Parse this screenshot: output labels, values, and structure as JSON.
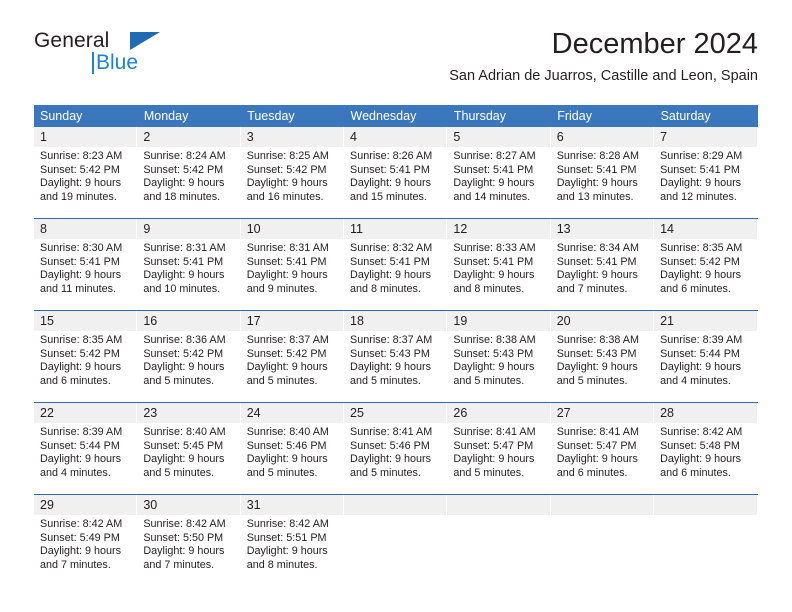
{
  "brand": {
    "name_part1": "General",
    "name_part2": "Blue",
    "triangle_color": "#1f6cb4",
    "blue_color": "#1f81d0"
  },
  "header": {
    "title": "December 2024",
    "subtitle": "San Adrian de Juarros, Castille and Leon, Spain"
  },
  "theme": {
    "header_bg": "#3b77bd",
    "header_text": "#ffffff",
    "daynum_bg": "#f0f0f0",
    "row_divider": "#2e6aa8",
    "body_text": "#231f20"
  },
  "calendar": {
    "weekday_headers": [
      "Sunday",
      "Monday",
      "Tuesday",
      "Wednesday",
      "Thursday",
      "Friday",
      "Saturday"
    ],
    "weeks": [
      [
        {
          "day": "1",
          "sunrise": "Sunrise: 8:23 AM",
          "sunset": "Sunset: 5:42 PM",
          "daylight_line1": "Daylight: 9 hours",
          "daylight_line2": "and 19 minutes."
        },
        {
          "day": "2",
          "sunrise": "Sunrise: 8:24 AM",
          "sunset": "Sunset: 5:42 PM",
          "daylight_line1": "Daylight: 9 hours",
          "daylight_line2": "and 18 minutes."
        },
        {
          "day": "3",
          "sunrise": "Sunrise: 8:25 AM",
          "sunset": "Sunset: 5:42 PM",
          "daylight_line1": "Daylight: 9 hours",
          "daylight_line2": "and 16 minutes."
        },
        {
          "day": "4",
          "sunrise": "Sunrise: 8:26 AM",
          "sunset": "Sunset: 5:41 PM",
          "daylight_line1": "Daylight: 9 hours",
          "daylight_line2": "and 15 minutes."
        },
        {
          "day": "5",
          "sunrise": "Sunrise: 8:27 AM",
          "sunset": "Sunset: 5:41 PM",
          "daylight_line1": "Daylight: 9 hours",
          "daylight_line2": "and 14 minutes."
        },
        {
          "day": "6",
          "sunrise": "Sunrise: 8:28 AM",
          "sunset": "Sunset: 5:41 PM",
          "daylight_line1": "Daylight: 9 hours",
          "daylight_line2": "and 13 minutes."
        },
        {
          "day": "7",
          "sunrise": "Sunrise: 8:29 AM",
          "sunset": "Sunset: 5:41 PM",
          "daylight_line1": "Daylight: 9 hours",
          "daylight_line2": "and 12 minutes."
        }
      ],
      [
        {
          "day": "8",
          "sunrise": "Sunrise: 8:30 AM",
          "sunset": "Sunset: 5:41 PM",
          "daylight_line1": "Daylight: 9 hours",
          "daylight_line2": "and 11 minutes."
        },
        {
          "day": "9",
          "sunrise": "Sunrise: 8:31 AM",
          "sunset": "Sunset: 5:41 PM",
          "daylight_line1": "Daylight: 9 hours",
          "daylight_line2": "and 10 minutes."
        },
        {
          "day": "10",
          "sunrise": "Sunrise: 8:31 AM",
          "sunset": "Sunset: 5:41 PM",
          "daylight_line1": "Daylight: 9 hours",
          "daylight_line2": "and 9 minutes."
        },
        {
          "day": "11",
          "sunrise": "Sunrise: 8:32 AM",
          "sunset": "Sunset: 5:41 PM",
          "daylight_line1": "Daylight: 9 hours",
          "daylight_line2": "and 8 minutes."
        },
        {
          "day": "12",
          "sunrise": "Sunrise: 8:33 AM",
          "sunset": "Sunset: 5:41 PM",
          "daylight_line1": "Daylight: 9 hours",
          "daylight_line2": "and 8 minutes."
        },
        {
          "day": "13",
          "sunrise": "Sunrise: 8:34 AM",
          "sunset": "Sunset: 5:41 PM",
          "daylight_line1": "Daylight: 9 hours",
          "daylight_line2": "and 7 minutes."
        },
        {
          "day": "14",
          "sunrise": "Sunrise: 8:35 AM",
          "sunset": "Sunset: 5:42 PM",
          "daylight_line1": "Daylight: 9 hours",
          "daylight_line2": "and 6 minutes."
        }
      ],
      [
        {
          "day": "15",
          "sunrise": "Sunrise: 8:35 AM",
          "sunset": "Sunset: 5:42 PM",
          "daylight_line1": "Daylight: 9 hours",
          "daylight_line2": "and 6 minutes."
        },
        {
          "day": "16",
          "sunrise": "Sunrise: 8:36 AM",
          "sunset": "Sunset: 5:42 PM",
          "daylight_line1": "Daylight: 9 hours",
          "daylight_line2": "and 5 minutes."
        },
        {
          "day": "17",
          "sunrise": "Sunrise: 8:37 AM",
          "sunset": "Sunset: 5:42 PM",
          "daylight_line1": "Daylight: 9 hours",
          "daylight_line2": "and 5 minutes."
        },
        {
          "day": "18",
          "sunrise": "Sunrise: 8:37 AM",
          "sunset": "Sunset: 5:43 PM",
          "daylight_line1": "Daylight: 9 hours",
          "daylight_line2": "and 5 minutes."
        },
        {
          "day": "19",
          "sunrise": "Sunrise: 8:38 AM",
          "sunset": "Sunset: 5:43 PM",
          "daylight_line1": "Daylight: 9 hours",
          "daylight_line2": "and 5 minutes."
        },
        {
          "day": "20",
          "sunrise": "Sunrise: 8:38 AM",
          "sunset": "Sunset: 5:43 PM",
          "daylight_line1": "Daylight: 9 hours",
          "daylight_line2": "and 5 minutes."
        },
        {
          "day": "21",
          "sunrise": "Sunrise: 8:39 AM",
          "sunset": "Sunset: 5:44 PM",
          "daylight_line1": "Daylight: 9 hours",
          "daylight_line2": "and 4 minutes."
        }
      ],
      [
        {
          "day": "22",
          "sunrise": "Sunrise: 8:39 AM",
          "sunset": "Sunset: 5:44 PM",
          "daylight_line1": "Daylight: 9 hours",
          "daylight_line2": "and 4 minutes."
        },
        {
          "day": "23",
          "sunrise": "Sunrise: 8:40 AM",
          "sunset": "Sunset: 5:45 PM",
          "daylight_line1": "Daylight: 9 hours",
          "daylight_line2": "and 5 minutes."
        },
        {
          "day": "24",
          "sunrise": "Sunrise: 8:40 AM",
          "sunset": "Sunset: 5:46 PM",
          "daylight_line1": "Daylight: 9 hours",
          "daylight_line2": "and 5 minutes."
        },
        {
          "day": "25",
          "sunrise": "Sunrise: 8:41 AM",
          "sunset": "Sunset: 5:46 PM",
          "daylight_line1": "Daylight: 9 hours",
          "daylight_line2": "and 5 minutes."
        },
        {
          "day": "26",
          "sunrise": "Sunrise: 8:41 AM",
          "sunset": "Sunset: 5:47 PM",
          "daylight_line1": "Daylight: 9 hours",
          "daylight_line2": "and 5 minutes."
        },
        {
          "day": "27",
          "sunrise": "Sunrise: 8:41 AM",
          "sunset": "Sunset: 5:47 PM",
          "daylight_line1": "Daylight: 9 hours",
          "daylight_line2": "and 6 minutes."
        },
        {
          "day": "28",
          "sunrise": "Sunrise: 8:42 AM",
          "sunset": "Sunset: 5:48 PM",
          "daylight_line1": "Daylight: 9 hours",
          "daylight_line2": "and 6 minutes."
        }
      ],
      [
        {
          "day": "29",
          "sunrise": "Sunrise: 8:42 AM",
          "sunset": "Sunset: 5:49 PM",
          "daylight_line1": "Daylight: 9 hours",
          "daylight_line2": "and 7 minutes."
        },
        {
          "day": "30",
          "sunrise": "Sunrise: 8:42 AM",
          "sunset": "Sunset: 5:50 PM",
          "daylight_line1": "Daylight: 9 hours",
          "daylight_line2": "and 7 minutes."
        },
        {
          "day": "31",
          "sunrise": "Sunrise: 8:42 AM",
          "sunset": "Sunset: 5:51 PM",
          "daylight_line1": "Daylight: 9 hours",
          "daylight_line2": "and 8 minutes."
        },
        {
          "day": "",
          "sunrise": "",
          "sunset": "",
          "daylight_line1": "",
          "daylight_line2": ""
        },
        {
          "day": "",
          "sunrise": "",
          "sunset": "",
          "daylight_line1": "",
          "daylight_line2": ""
        },
        {
          "day": "",
          "sunrise": "",
          "sunset": "",
          "daylight_line1": "",
          "daylight_line2": ""
        },
        {
          "day": "",
          "sunrise": "",
          "sunset": "",
          "daylight_line1": "",
          "daylight_line2": ""
        }
      ]
    ]
  }
}
